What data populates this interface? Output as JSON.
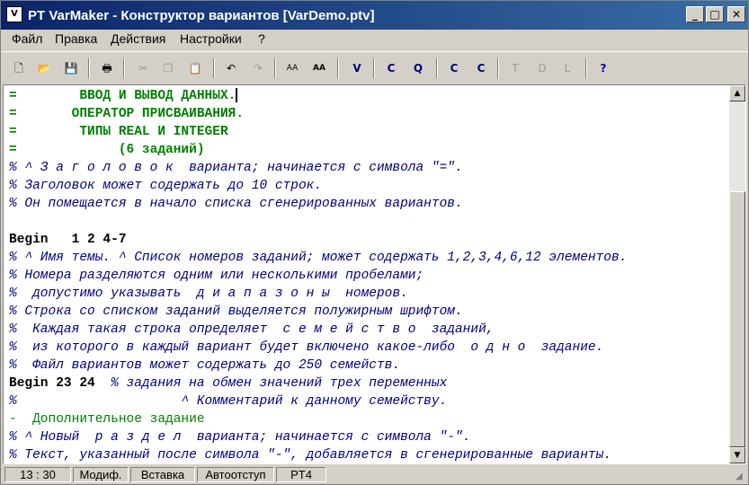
{
  "window": {
    "title": "PT VarMaker - Конструктор вариантов [VarDemo.ptv]",
    "app_icon_text": "V",
    "minimize": "_",
    "maximize": "□",
    "close": "✕"
  },
  "menu": [
    "Файл",
    "Правка",
    "Действия",
    "Настройки",
    "?"
  ],
  "toolbar": {
    "icons": [
      "new-icon",
      "open-icon",
      "save-icon",
      "print-icon",
      "cut-icon",
      "copy-icon",
      "paste-icon",
      "undo-icon",
      "redo-icon",
      "font-icon",
      "font-bold-icon",
      "v-icon",
      "c-icon",
      "c-search-icon",
      "c-list-icon",
      "c-gear-icon",
      "t-icon",
      "t-d-icon",
      "t-l-icon",
      "help-icon"
    ],
    "glyphs": {
      "new": "🗋",
      "open": "📂",
      "save": "💾",
      "print": "🖶",
      "cut": "✂",
      "copy": "❐",
      "paste": "📋",
      "undo": "↶",
      "redo": "↷",
      "font": "AA",
      "font2": "AA",
      "v": "V",
      "c1": "C",
      "c2": "Q",
      "c3": "C",
      "c4": "C",
      "t1": "T",
      "t2": "D",
      "t3": "L",
      "help": "?"
    }
  },
  "editor": {
    "lines": [
      {
        "type": "title",
        "text": "=        ВВОД И ВЫВОД ДАННЫХ."
      },
      {
        "type": "title",
        "text": "=       ОПЕРАТОР ПРИСВАИВАНИЯ."
      },
      {
        "type": "title",
        "text": "=        ТИПЫ REAL И INTEGER"
      },
      {
        "type": "title",
        "text": "=             (6 заданий)"
      },
      {
        "type": "comment",
        "text": "% ^ З а г о л о в о к  варианта; начинается с символа \"=\"."
      },
      {
        "type": "comment",
        "text": "% Заголовок может содержать до 10 строк."
      },
      {
        "type": "comment",
        "text": "% Он помещается в начало списка сгенерированных вариантов."
      },
      {
        "type": "blank",
        "text": ""
      },
      {
        "type": "begin",
        "text": "Begin   1 2 4-7"
      },
      {
        "type": "comment",
        "text": "% ^ Имя темы. ^ Список номеров заданий; может содержать 1,2,3,4,6,12 элементов."
      },
      {
        "type": "comment",
        "text": "% Номера разделяются одним или несколькими пробелами;"
      },
      {
        "type": "comment",
        "text": "%  допустимо указывать  д и а п а з о н ы  номеров."
      },
      {
        "type": "comment",
        "text": "% Строка со списком заданий выделяется полужирным шрифтом."
      },
      {
        "type": "comment",
        "text": "%  Каждая такая строка определяет  с е м е й с т в о  заданий,"
      },
      {
        "type": "comment",
        "text": "%  из которого в каждый вариант будет включено какое-либо  о д н о  задание."
      },
      {
        "type": "comment",
        "text": "%  Файл вариантов может содержать до 250 семейств."
      },
      {
        "type": "mixed",
        "begin": "Begin 23 24  ",
        "comment": "% задания на обмен значений трех переменных"
      },
      {
        "type": "comment",
        "text": "%                     ^ Комментарий к данному семейству."
      },
      {
        "type": "section",
        "text": "-  Дополнительное задание"
      },
      {
        "type": "comment",
        "text": "% ^ Новый  р а з д е л  варианта; начинается с символа \"-\"."
      },
      {
        "type": "comment",
        "text": "% Текст, указанный после символа \"-\", добавляется в сгенерированные варианты."
      }
    ]
  },
  "scrollbar": {
    "up": "▲",
    "down": "▼"
  },
  "status": {
    "position": "13 : 30",
    "modified": "Модиф.",
    "insert": "Вставка",
    "autoindent": "Автоотступ",
    "mode": "PT4"
  },
  "colors": {
    "title_green": "#008000",
    "comment_navy": "#000080",
    "titlebar": "#0a246a"
  }
}
